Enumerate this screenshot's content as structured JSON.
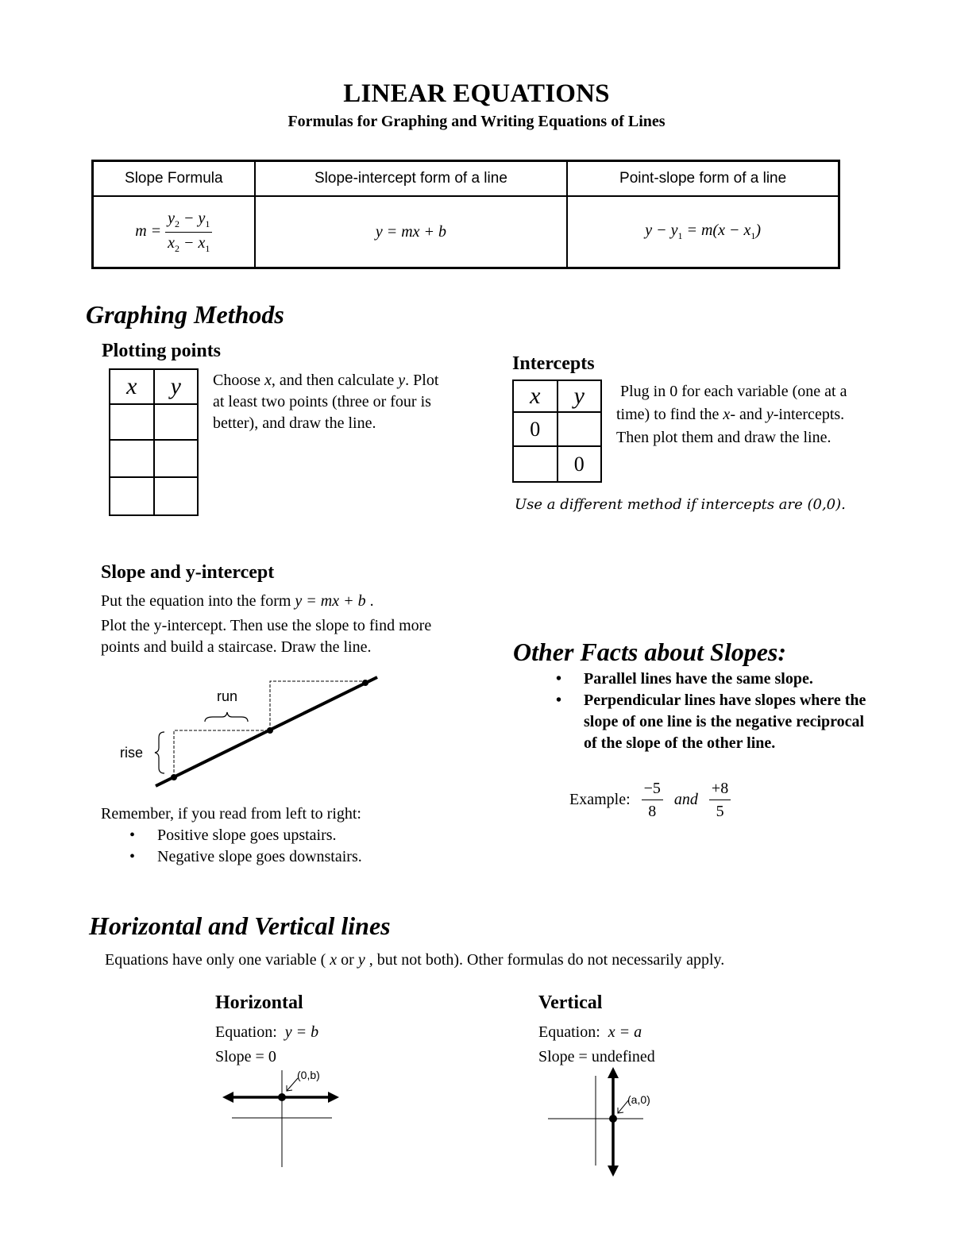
{
  "header": {
    "title": "LINEAR EQUATIONS",
    "subtitle": "Formulas for Graphing and Writing Equations of Lines"
  },
  "formula_table": {
    "columns": [
      "Slope Formula",
      "Slope-intercept form of a line",
      "Point-slope form of a line"
    ],
    "slope_formula": {
      "lhs": "m =",
      "numerator": [
        "y",
        "2",
        " − y",
        "1"
      ],
      "denominator": [
        "x",
        "2",
        " − x",
        "1"
      ]
    },
    "slope_intercept": "y = mx + b",
    "point_slope": {
      "part1": "y − y",
      "sub1": "1",
      "part2": " = m(x − x",
      "sub2": "1",
      "part3": ")"
    }
  },
  "graphing_methods": {
    "heading": "Graphing Methods",
    "plotting_points": {
      "heading": "Plotting points",
      "table_headers": [
        "x",
        "y"
      ],
      "table_rows": [
        [
          "",
          ""
        ],
        [
          "",
          ""
        ],
        [
          "",
          ""
        ]
      ],
      "text_parts": [
        "Choose ",
        "x",
        ", and then calculate ",
        "y",
        "."
      ],
      "text_rest": "Plot at least two points (three or four is better), and draw the line."
    },
    "intercepts": {
      "heading": "Intercepts",
      "table_headers": [
        "x",
        "y"
      ],
      "table_rows": [
        [
          "0",
          ""
        ],
        [
          "",
          "0"
        ]
      ],
      "text_a": "Plug in 0 for each variable (one at a time) to find the ",
      "var_x": "x",
      "text_b": "- and ",
      "var_y": "y",
      "text_c": "-intercepts. Then plot them and draw the line.",
      "note": "Use a different method if intercepts are (0,0)."
    },
    "slope_intercept": {
      "heading": "Slope and y-intercept",
      "line1_text": "Put the equation into the form ",
      "line1_eq": "y = mx + b",
      "line1_end": " .",
      "line2": "Plot the y-intercept. Then use the slope to find more points and build a staircase. Draw the line.",
      "diagram": {
        "run_label": "run",
        "rise_label": "rise"
      },
      "remember": "Remember, if you read from left to right:",
      "bullets": [
        "Positive slope goes upstairs.",
        "Negative slope goes downstairs."
      ]
    }
  },
  "other_facts": {
    "heading": "Other Facts about Slopes:",
    "bullets": [
      "Parallel lines have the same slope.",
      "Perpendicular lines have slopes where the slope of one line is the negative reciprocal of the slope of the other line."
    ],
    "example_label": "Example:",
    "example_frac1": {
      "num": "−5",
      "den": "8"
    },
    "example_and": "and",
    "example_frac2": {
      "num": "+8",
      "den": "5"
    }
  },
  "horiz_vert": {
    "heading": "Horizontal and Vertical lines",
    "intro_a": "Equations have only one variable ( ",
    "intro_x": "x",
    "intro_b": " or ",
    "intro_y": "y",
    "intro_c": " , but not both).  Other formulas do not necessarily apply.",
    "horizontal": {
      "heading": "Horizontal",
      "equation_label": "Equation:",
      "equation": "y = b",
      "slope": "Slope = 0",
      "point_label": "(0,b)"
    },
    "vertical": {
      "heading": "Vertical",
      "equation_label": "Equation:",
      "equation": "x = a",
      "slope": "Slope = undefined",
      "point_label": "(a,0)"
    }
  }
}
